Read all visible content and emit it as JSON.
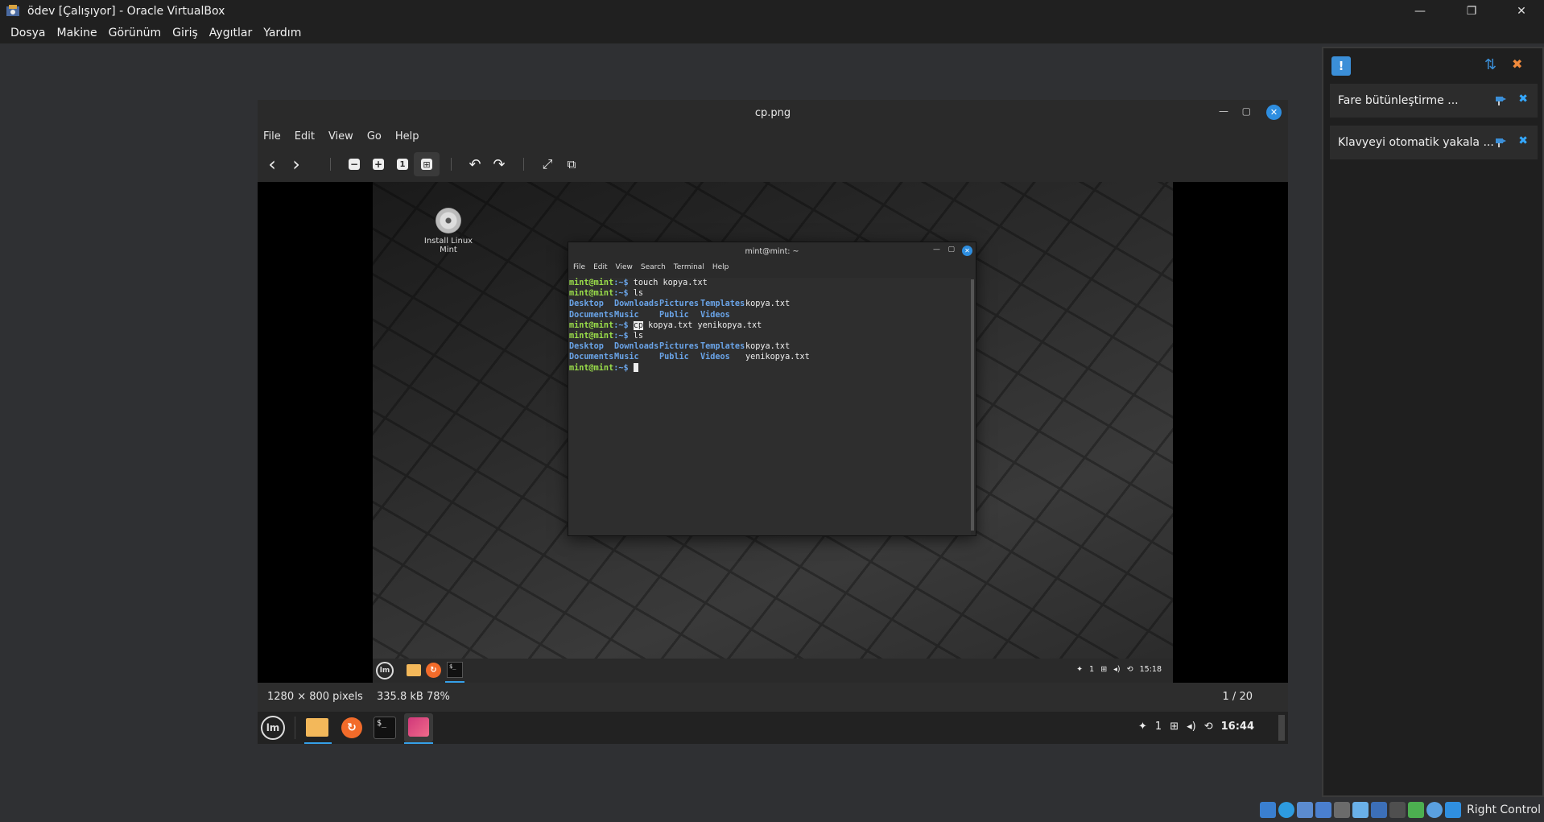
{
  "host": {
    "title": "ödev [Çalışıyor] - Oracle VirtualBox",
    "window_controls": {
      "minimize": "—",
      "restore": "❐",
      "close": "✕"
    },
    "menu": [
      "Dosya",
      "Makine",
      "Görünüm",
      "Giriş",
      "Aygıtlar",
      "Yardım"
    ],
    "host_key": "Right Control"
  },
  "side_panel": {
    "notifications": [
      {
        "text": "Fare bütünleştirme ..."
      },
      {
        "text": "Klavyeyi otomatik yakala ..."
      }
    ],
    "close_glyph": "✖"
  },
  "viewer": {
    "title": "cp.png",
    "menu": [
      "File",
      "Edit",
      "View",
      "Go",
      "Help"
    ],
    "toolbar_glyphs": {
      "prev": "‹",
      "next": "›",
      "zoom_out": "−",
      "zoom_in": "+",
      "best_fit": "1",
      "fit": "⊞",
      "rotate_left": "↶",
      "rotate_right": "↷",
      "fullscreen": "⤢",
      "slideshow": "⧉"
    },
    "status": {
      "dimensions": "1280 × 800 pixels",
      "size": "335.8 kB",
      "zoom": "78%",
      "position": "1 / 20"
    }
  },
  "guest_panel": {
    "notifications_count": "1",
    "clock": "16:44",
    "logo": "lm",
    "terminal_glyph": "$_"
  },
  "screenshot": {
    "desktop_icon_label": "Install Linux Mint",
    "terminal": {
      "title": "mint@mint: ~",
      "menu": [
        "File",
        "Edit",
        "View",
        "Search",
        "Terminal",
        "Help"
      ],
      "prompt_user": "mint@mint",
      "prompt_path": ":~$",
      "cmd1": " touch kopya.txt",
      "cmd2": " ls",
      "ls1_row1": [
        "Desktop",
        "Downloads",
        "Pictures",
        "Templates"
      ],
      "ls1_row1_file": "kopya.txt",
      "ls1_row2": [
        "Documents",
        "Music",
        "Public",
        "Videos"
      ],
      "cmd3_hl": "cp",
      "cmd3_rest": " kopya.txt yenikopya.txt",
      "cmd4": " ls",
      "ls2_row1": [
        "Desktop",
        "Downloads",
        "Pictures",
        "Templates"
      ],
      "ls2_row1_file": "kopya.txt",
      "ls2_row2": [
        "Documents",
        "Music",
        "Public",
        "Videos"
      ],
      "ls2_row2_file": "yenikopya.txt"
    },
    "panel": {
      "notifications_count": "1",
      "clock": "15:18",
      "logo": "lm",
      "terminal_glyph": "$_"
    }
  },
  "colors": {
    "accent": "#2e8ee0",
    "prompt_green": "#9ade4a",
    "dir_blue": "#6aa4e8"
  }
}
